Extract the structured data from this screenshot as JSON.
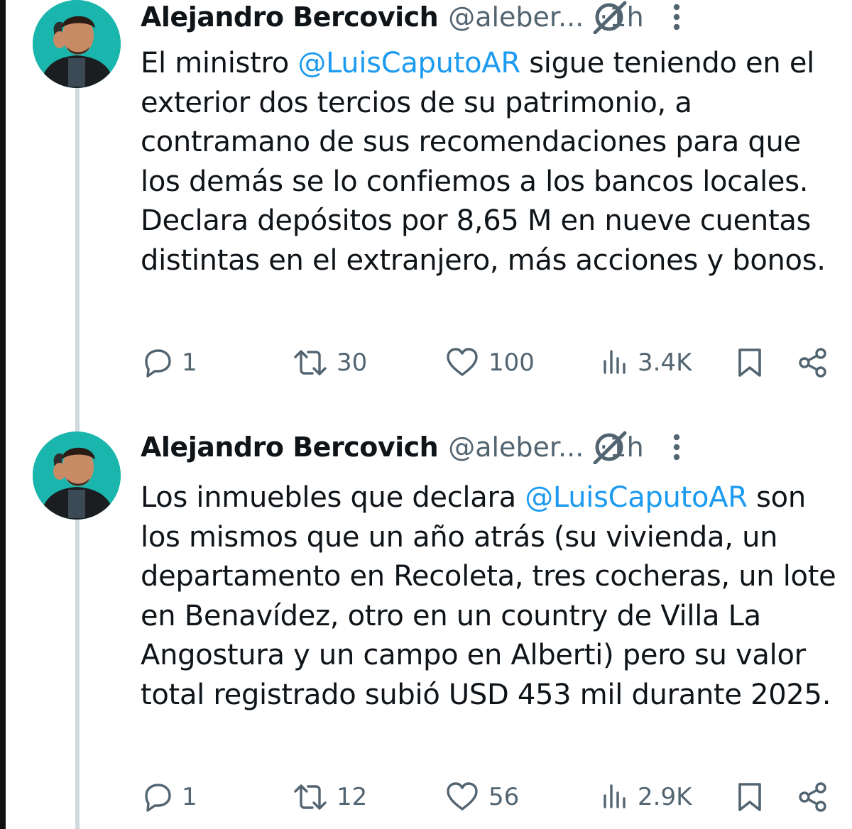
{
  "tweets": [
    {
      "author": {
        "name": "Alejandro Bercovich",
        "handle": "@aleber...",
        "time": "1h",
        "separator": "·"
      },
      "body": {
        "before": "El ministro ",
        "mention": "@LuisCaputoAR",
        "after": " sigue teniendo en el exterior dos tercios de su patrimonio, a contramano de sus recomendaciones para que los demás se lo confiemos a los bancos locales. Declara depósitos por 8,65 M en nueve cuentas distintas en el extranjero, más acciones y bonos."
      },
      "stats": {
        "replies": "1",
        "retweets": "30",
        "likes": "100",
        "views": "3.4K"
      }
    },
    {
      "author": {
        "name": "Alejandro Bercovich",
        "handle": "@aleber...",
        "time": "1h",
        "separator": "·"
      },
      "body": {
        "before": "Los inmuebles que declara ",
        "mention": "@LuisCaputoAR",
        "after": " son los mismos que un año atrás (su vivienda, un departamento en Recoleta, tres cocheras, un lote en Benavídez, otro en un country de Villa La Angostura y un campo en Alberti) pero su valor total registrado subió USD 453 mil durante 2025."
      },
      "stats": {
        "replies": "1",
        "retweets": "12",
        "likes": "56",
        "views": "2.9K"
      }
    }
  ],
  "icons": {
    "reply": "reply-icon",
    "retweet": "retweet-icon",
    "like": "heart-icon",
    "views": "views-icon",
    "bookmark": "bookmark-icon",
    "share": "share-icon",
    "grok": "grok-icon",
    "more": "more-icon"
  },
  "colors": {
    "mention": "#1d9bf0",
    "secondary_text": "#536471",
    "primary_text": "#0f1419",
    "thread_line": "#cfd9de",
    "avatar_bg": "#1ab6ad"
  }
}
